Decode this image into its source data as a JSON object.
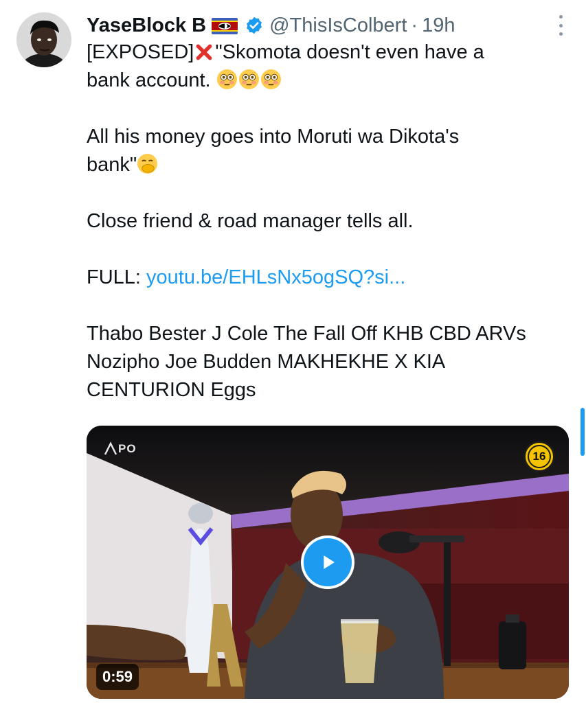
{
  "tweet": {
    "author_name": "YaseBlock B",
    "handle": "@ThisIsColbert",
    "separator": "·",
    "timestamp": "19h",
    "lines": {
      "p1_tag": "[EXPOSED]",
      "p1_quote_a": "\"Skomota doesn't even have a",
      "p1_quote_b": "bank account.",
      "p2_a": "All his money goes into Moruti wa Dikota's",
      "p2_b": "bank\"",
      "p3": "Close friend & road manager tells all.",
      "p4_label": "FULL:",
      "p4_link": "youtu.be/EHLsNx5ogSQ?si...",
      "p5_a": "Thabo Bester J Cole The Fall Off KHB CBD ARVs",
      "p5_b": "Nozipho Joe Budden MAKHEKHE X KIA",
      "p5_c": "CENTURION Eggs"
    }
  },
  "video": {
    "duration": "0:59",
    "age_rating": "16",
    "watermark": "PO"
  },
  "icons": {
    "flag": "eswatini-flag-icon",
    "verified": "verified-badge-icon",
    "more": "more-options-icon",
    "cross": "cross-mark-emoji",
    "flushed": "flushed-face-emoji",
    "shush": "face-with-hand-over-mouth-emoji",
    "play": "play-icon"
  },
  "colors": {
    "link": "#1d9bf0",
    "verified": "#1d9bf0",
    "muted": "#536471",
    "text": "#0f1419"
  }
}
